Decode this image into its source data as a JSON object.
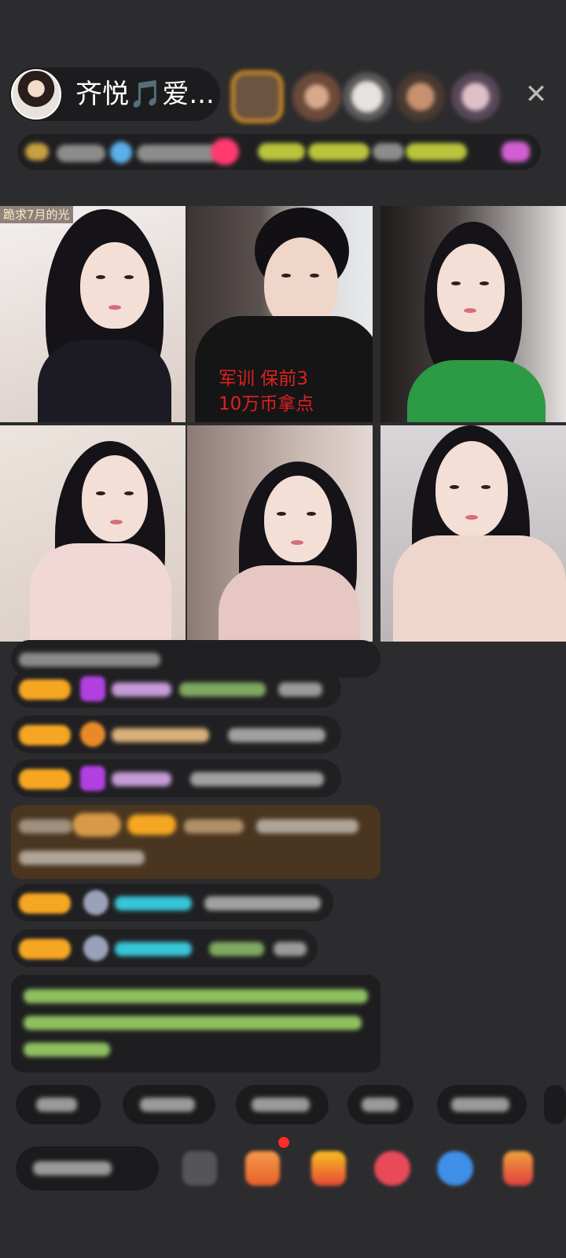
{
  "header": {
    "host_name": "齐悦🎵爱...",
    "viewer_avatars": [
      "viewer-avatar-1",
      "viewer-avatar-2",
      "viewer-avatar-3",
      "viewer-avatar-4",
      "viewer-avatar-5"
    ],
    "close_icon": "✕"
  },
  "video_grid": {
    "tile1_tag": "跪求7月的光",
    "tile2_overlay_line1": "军训 保前3",
    "tile2_overlay_line2": "10万币拿点"
  },
  "colors": {
    "background": "#2c2c2e",
    "badge": "#f5a623",
    "overlay_red": "#e0201f",
    "gift_box": "#4a3620",
    "system_text": "#8fc060",
    "cyan_name": "#38c5d8"
  },
  "icons": {
    "close": "close-icon",
    "tools": [
      "more-icon",
      "gift-box-icon",
      "treasure-icon",
      "pk-icon",
      "game-icon",
      "red-packet-icon"
    ]
  }
}
